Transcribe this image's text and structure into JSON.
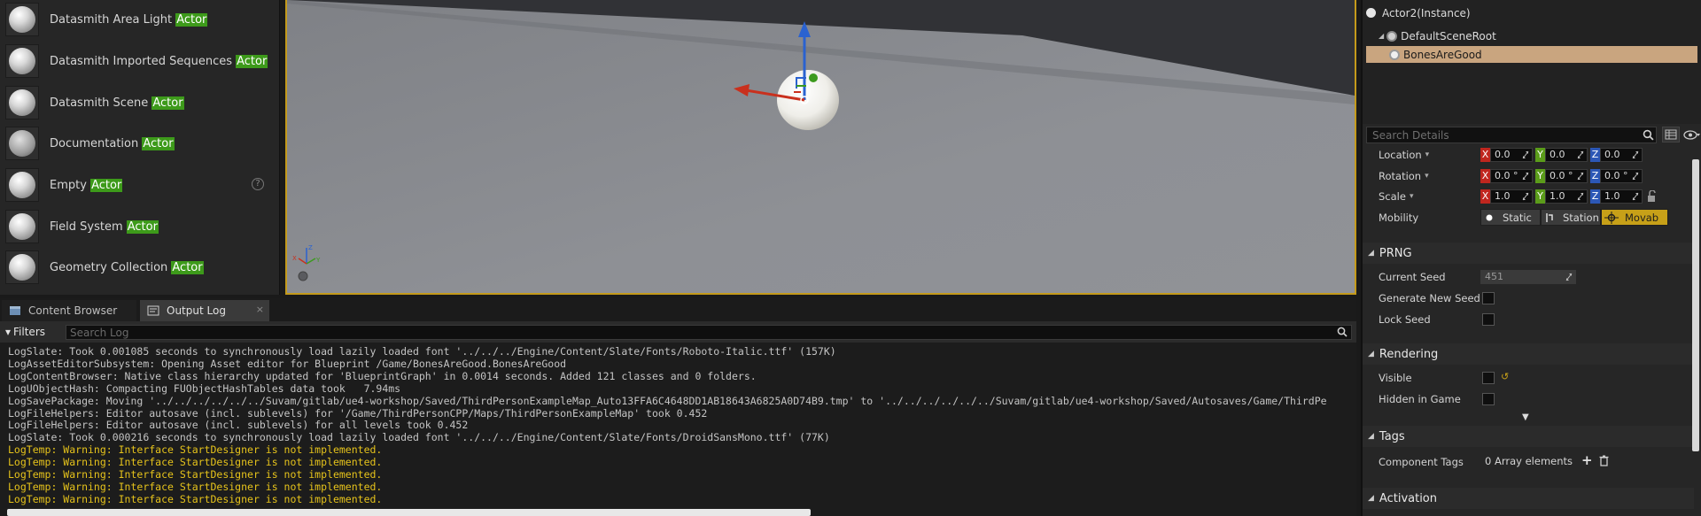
{
  "place_actors": [
    {
      "prefix": "Datasmith Area Light ",
      "highlight": "Actor",
      "icon": "sphere-icon"
    },
    {
      "prefix": "Datasmith Imported Sequences ",
      "highlight": "Actor",
      "icon": "sphere-icon"
    },
    {
      "prefix": "Datasmith Scene ",
      "highlight": "Actor",
      "icon": "sphere-icon"
    },
    {
      "prefix": "Documentation ",
      "highlight": "Actor",
      "icon": "question-sphere-icon"
    },
    {
      "prefix": "Empty ",
      "highlight": "Actor",
      "icon": "sphere-icon",
      "help": "?"
    },
    {
      "prefix": "Field System ",
      "highlight": "Actor",
      "icon": "sphere-icon"
    },
    {
      "prefix": "Geometry Collection ",
      "highlight": "Actor",
      "icon": "sphere-icon"
    }
  ],
  "tabs": [
    {
      "label": "Content Browser",
      "icon": "content-browser-icon",
      "active": false
    },
    {
      "label": "Output Log",
      "icon": "output-log-icon",
      "active": true,
      "close": "×"
    }
  ],
  "log": {
    "filters_label": "Filters",
    "filters_caret": "▾",
    "search_placeholder": "Search Log",
    "lines": [
      {
        "text": "LogSlate: Took 0.001085 seconds to synchronously load lazily loaded font '../../../Engine/Content/Slate/Fonts/Roboto-Italic.ttf' (157K)",
        "level": "info"
      },
      {
        "text": "LogAssetEditorSubsystem: Opening Asset editor for Blueprint /Game/BonesAreGood.BonesAreGood",
        "level": "info"
      },
      {
        "text": "LogContentBrowser: Native class hierarchy updated for 'BlueprintGraph' in 0.0014 seconds. Added 121 classes and 0 folders.",
        "level": "info"
      },
      {
        "text": "LogUObjectHash: Compacting FUObjectHashTables data took   7.94ms",
        "level": "info"
      },
      {
        "text": "LogSavePackage: Moving '../../../../../../Suvam/gitlab/ue4-workshop/Saved/ThirdPersonExampleMap_Auto13FFA6C4648DD1AB18643A6825A0D74B9.tmp' to '../../../../../../Suvam/gitlab/ue4-workshop/Saved/Autosaves/Game/ThirdPe",
        "level": "info"
      },
      {
        "text": "LogFileHelpers: Editor autosave (incl. sublevels) for '/Game/ThirdPersonCPP/Maps/ThirdPersonExampleMap' took 0.452",
        "level": "info"
      },
      {
        "text": "LogFileHelpers: Editor autosave (incl. sublevels) for all levels took 0.452",
        "level": "info"
      },
      {
        "text": "LogSlate: Took 0.000216 seconds to synchronously load lazily loaded font '../../../Engine/Content/Slate/Fonts/DroidSansMono.ttf' (77K)",
        "level": "info"
      },
      {
        "text": "LogTemp: Warning: Interface StartDesigner is not implemented.",
        "level": "warning"
      },
      {
        "text": "LogTemp: Warning: Interface StartDesigner is not implemented.",
        "level": "warning"
      },
      {
        "text": "LogTemp: Warning: Interface StartDesigner is not implemented.",
        "level": "warning"
      },
      {
        "text": "LogTemp: Warning: Interface StartDesigner is not implemented.",
        "level": "warning"
      },
      {
        "text": "LogTemp: Warning: Interface StartDesigner is not implemented.",
        "level": "warning"
      }
    ]
  },
  "components": {
    "root_label": "Actor2(Instance)",
    "scene_root": "DefaultSceneRoot",
    "selected": "BonesAreGood"
  },
  "details": {
    "search_placeholder": "Search Details",
    "transform": {
      "location": {
        "label": "Location",
        "x": "0.0",
        "y": "0.0",
        "z": "0.0"
      },
      "rotation": {
        "label": "Rotation",
        "x": "0.0 °",
        "y": "0.0 °",
        "z": "0.0 °"
      },
      "scale": {
        "label": "Scale",
        "x": "1.0",
        "y": "1.0",
        "z": "1.0"
      },
      "axis_x": "X",
      "axis_y": "Y",
      "axis_z": "Z",
      "caret": "▾"
    },
    "mobility": {
      "label": "Mobility",
      "options": [
        "Static",
        "Station",
        "Movab"
      ],
      "selected": "Movab"
    },
    "prng": {
      "title": "PRNG",
      "current_seed_label": "Current Seed",
      "current_seed_value": "451",
      "generate_label": "Generate New Seed",
      "lock_label": "Lock Seed"
    },
    "rendering": {
      "title": "Rendering",
      "visible_label": "Visible",
      "visible_reset": "↺",
      "hidden_label": "Hidden in Game"
    },
    "tags": {
      "title": "Tags",
      "component_tags_label": "Component Tags",
      "component_tags_value": "0 Array elements",
      "add": "+"
    },
    "activation": {
      "title": "Activation"
    },
    "section_caret": "◢",
    "scroll_caret": "▼"
  },
  "colors": {
    "highlight_green": "#3d9a1a",
    "warning_yellow": "#e6c31b",
    "selection_tan": "#c9a57f",
    "mobility_active": "#c7a018",
    "viewport_border": "#c49a1b"
  }
}
